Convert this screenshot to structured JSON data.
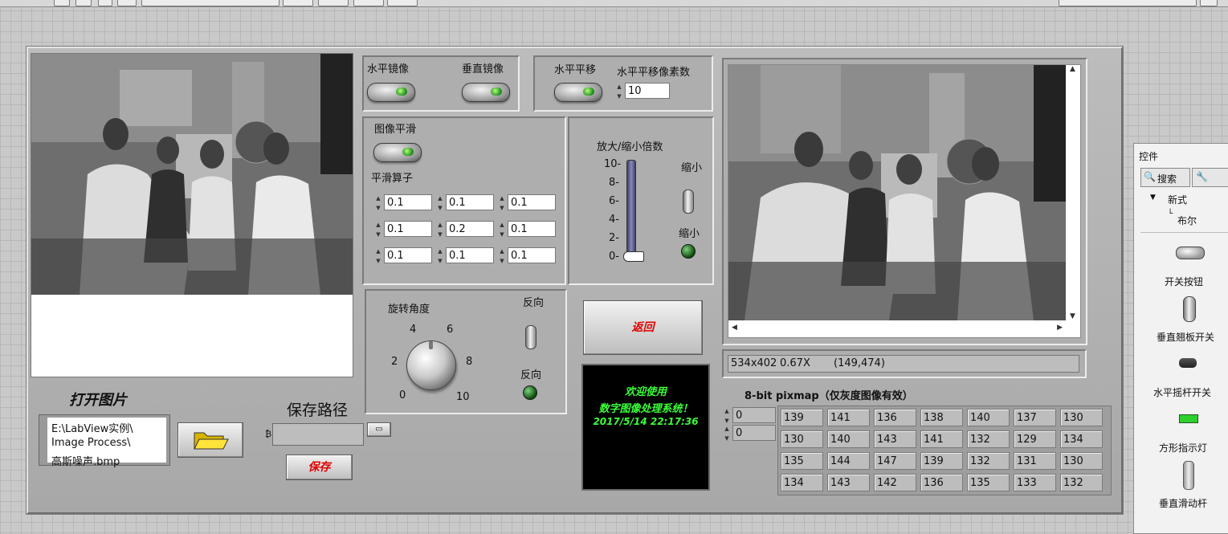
{
  "left_panel": {
    "open_image_label": "打开图片",
    "path_lines": [
      "E:\\LabView实例\\",
      "Image Process\\",
      "高斯噪声.bmp"
    ],
    "save_path_label": "保存路径",
    "save_path_value": "",
    "save_button_label": "保存"
  },
  "mirror": {
    "horizontal_label": "水平镜像",
    "vertical_label": "垂直镜像"
  },
  "shift": {
    "label": "水平平移",
    "pixels_label": "水平平移像素数",
    "pixels_value": "10"
  },
  "smoothing": {
    "label": "图像平滑",
    "operator_label": "平滑算子",
    "matrix": [
      [
        "0.1",
        "0.1",
        "0.1"
      ],
      [
        "0.1",
        "0.2",
        "0.1"
      ],
      [
        "0.1",
        "0.1",
        "0.1"
      ]
    ]
  },
  "zoom": {
    "label": "放大/缩小倍数",
    "scale_ticks": [
      "10-",
      "8-",
      "6-",
      "4-",
      "2-",
      "0-"
    ],
    "switch_label": "缩小",
    "indicator_label": "缩小",
    "level": 0
  },
  "rotation": {
    "label": "旋转角度",
    "dial_ticks": [
      "0",
      "2",
      "4",
      "6",
      "8",
      "10"
    ],
    "reverse_switch_label": "反向",
    "reverse_indicator_label": "反向"
  },
  "return_button_label": "返回",
  "welcome": {
    "line1": "欢迎使用",
    "line2": "数字图像处理系统！",
    "datetime": "2017/5/14 22:17:36"
  },
  "image_info": {
    "size": "534x402",
    "zoom": "0.67X",
    "coords": "(149,474)"
  },
  "pixmap": {
    "label": "8-bit pixmap（仅灰度图像有效）",
    "row_index": "0",
    "col_index": "0",
    "rows": [
      [
        "139",
        "141",
        "136",
        "138",
        "140",
        "137",
        "130"
      ],
      [
        "130",
        "140",
        "143",
        "141",
        "132",
        "129",
        "134"
      ],
      [
        "135",
        "144",
        "147",
        "139",
        "132",
        "131",
        "130"
      ],
      [
        "134",
        "143",
        "142",
        "136",
        "135",
        "133",
        "132"
      ]
    ]
  },
  "controls_palette": {
    "title": "控件",
    "search_label": "搜索",
    "tree_new": "新式",
    "tree_bool": "布尔",
    "items": [
      "开关按钮",
      "垂直翘板开关",
      "水平摇杆开关",
      "方形指示灯",
      "垂直滑动杆"
    ]
  }
}
